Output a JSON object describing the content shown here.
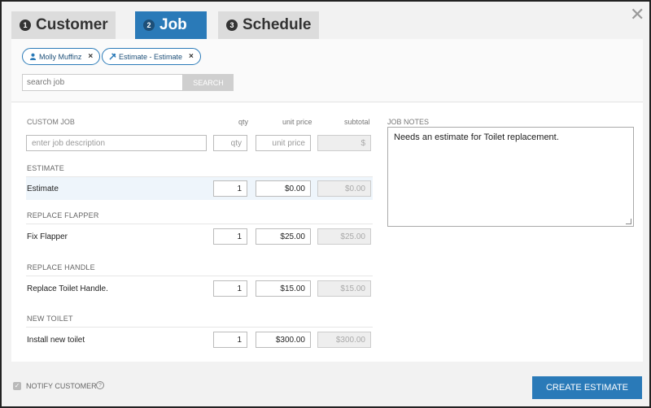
{
  "tabs": [
    {
      "num": "1",
      "label": "Customer"
    },
    {
      "num": "2",
      "label": "Job"
    },
    {
      "num": "3",
      "label": "Schedule"
    }
  ],
  "close_icon": "close-icon",
  "chips": [
    {
      "icon": "user-icon",
      "label": "Molly Muffinz",
      "remove": "×"
    },
    {
      "icon": "tools-icon",
      "label": "Estimate - Estimate",
      "remove": "×"
    }
  ],
  "search": {
    "placeholder": "search job",
    "button": "SEARCH"
  },
  "headers": {
    "custom_job": "CUSTOM JOB",
    "qty": "qty",
    "unit_price": "unit price",
    "subtotal": "subtotal",
    "job_notes": "JOB NOTES"
  },
  "custom_row": {
    "description_placeholder": "enter job description",
    "qty_placeholder": "qty",
    "price_placeholder": "unit price",
    "subtotal_placeholder": "$"
  },
  "sections": [
    {
      "title": "ESTIMATE",
      "item": "Estimate",
      "qty": "1",
      "unit_price": "$0.00",
      "subtotal": "$0.00"
    },
    {
      "title": "REPLACE FLAPPER",
      "item": "Fix Flapper",
      "qty": "1",
      "unit_price": "$25.00",
      "subtotal": "$25.00"
    },
    {
      "title": "REPLACE HANDLE",
      "item": "Replace Toilet Handle.",
      "qty": "1",
      "unit_price": "$15.00",
      "subtotal": "$15.00"
    },
    {
      "title": "NEW TOILET",
      "item": "Install new toilet",
      "qty": "1",
      "unit_price": "$300.00",
      "subtotal": "$300.00"
    }
  ],
  "job_notes": "Needs an estimate for Toilet replacement.",
  "footer": {
    "notify_label": "NOTIFY CUSTOMER",
    "help": "?",
    "create_button": "CREATE ESTIMATE",
    "checkbox": "✓"
  },
  "colors": {
    "accent": "#2a7ab8"
  }
}
